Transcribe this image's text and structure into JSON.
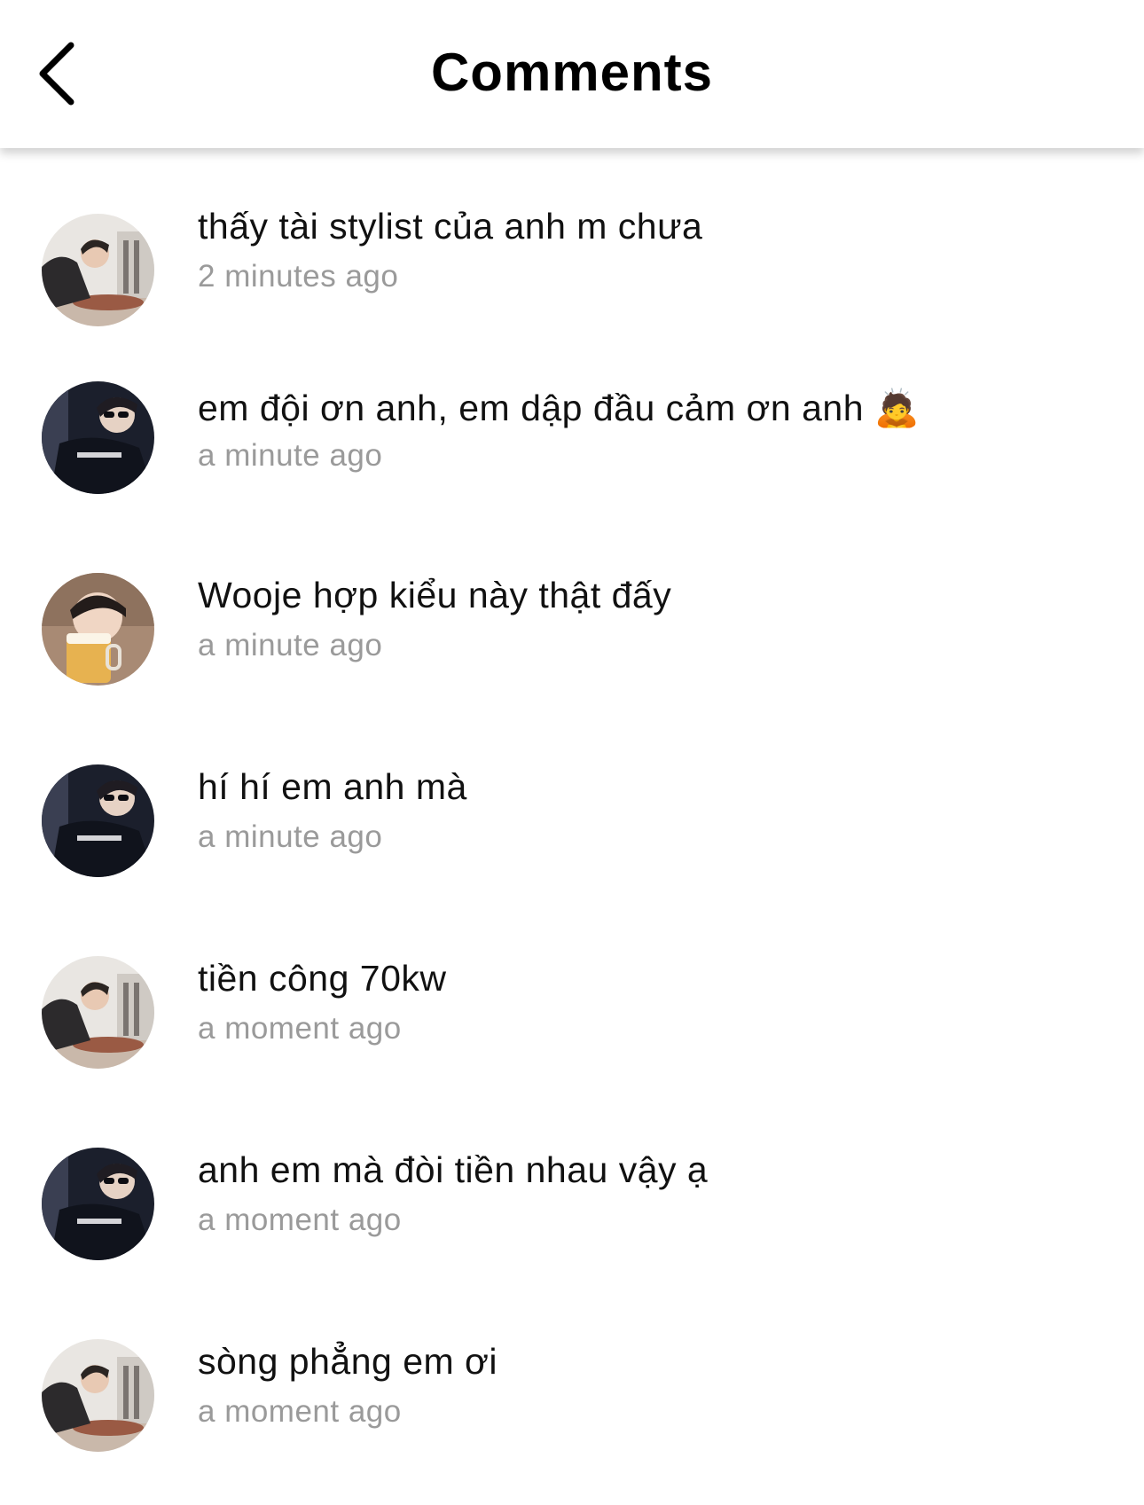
{
  "header": {
    "title": "Comments",
    "back_icon": "chevron-left-icon"
  },
  "comments": [
    {
      "avatar": "avatar-photo-office",
      "text": "thấy tài stylist của anh m chưa",
      "time": "2 minutes ago"
    },
    {
      "avatar": "avatar-photo-sunglasses",
      "text": "em đội ơn anh, em dập đầu cảm ơn anh 🙇",
      "time": "a minute ago"
    },
    {
      "avatar": "avatar-photo-beer",
      "text": "Wooje hợp kiểu này thật đấy",
      "time": "a minute ago"
    },
    {
      "avatar": "avatar-photo-sunglasses",
      "text": "hí hí em anh mà",
      "time": "a minute ago"
    },
    {
      "avatar": "avatar-photo-office",
      "text": "tiền công 70kw",
      "time": "a moment ago"
    },
    {
      "avatar": "avatar-photo-sunglasses",
      "text": "anh em mà đòi tiền nhau vậy ạ",
      "time": "a moment ago"
    },
    {
      "avatar": "avatar-photo-office",
      "text": "sòng phẳng em ơi",
      "time": "a moment ago"
    }
  ]
}
